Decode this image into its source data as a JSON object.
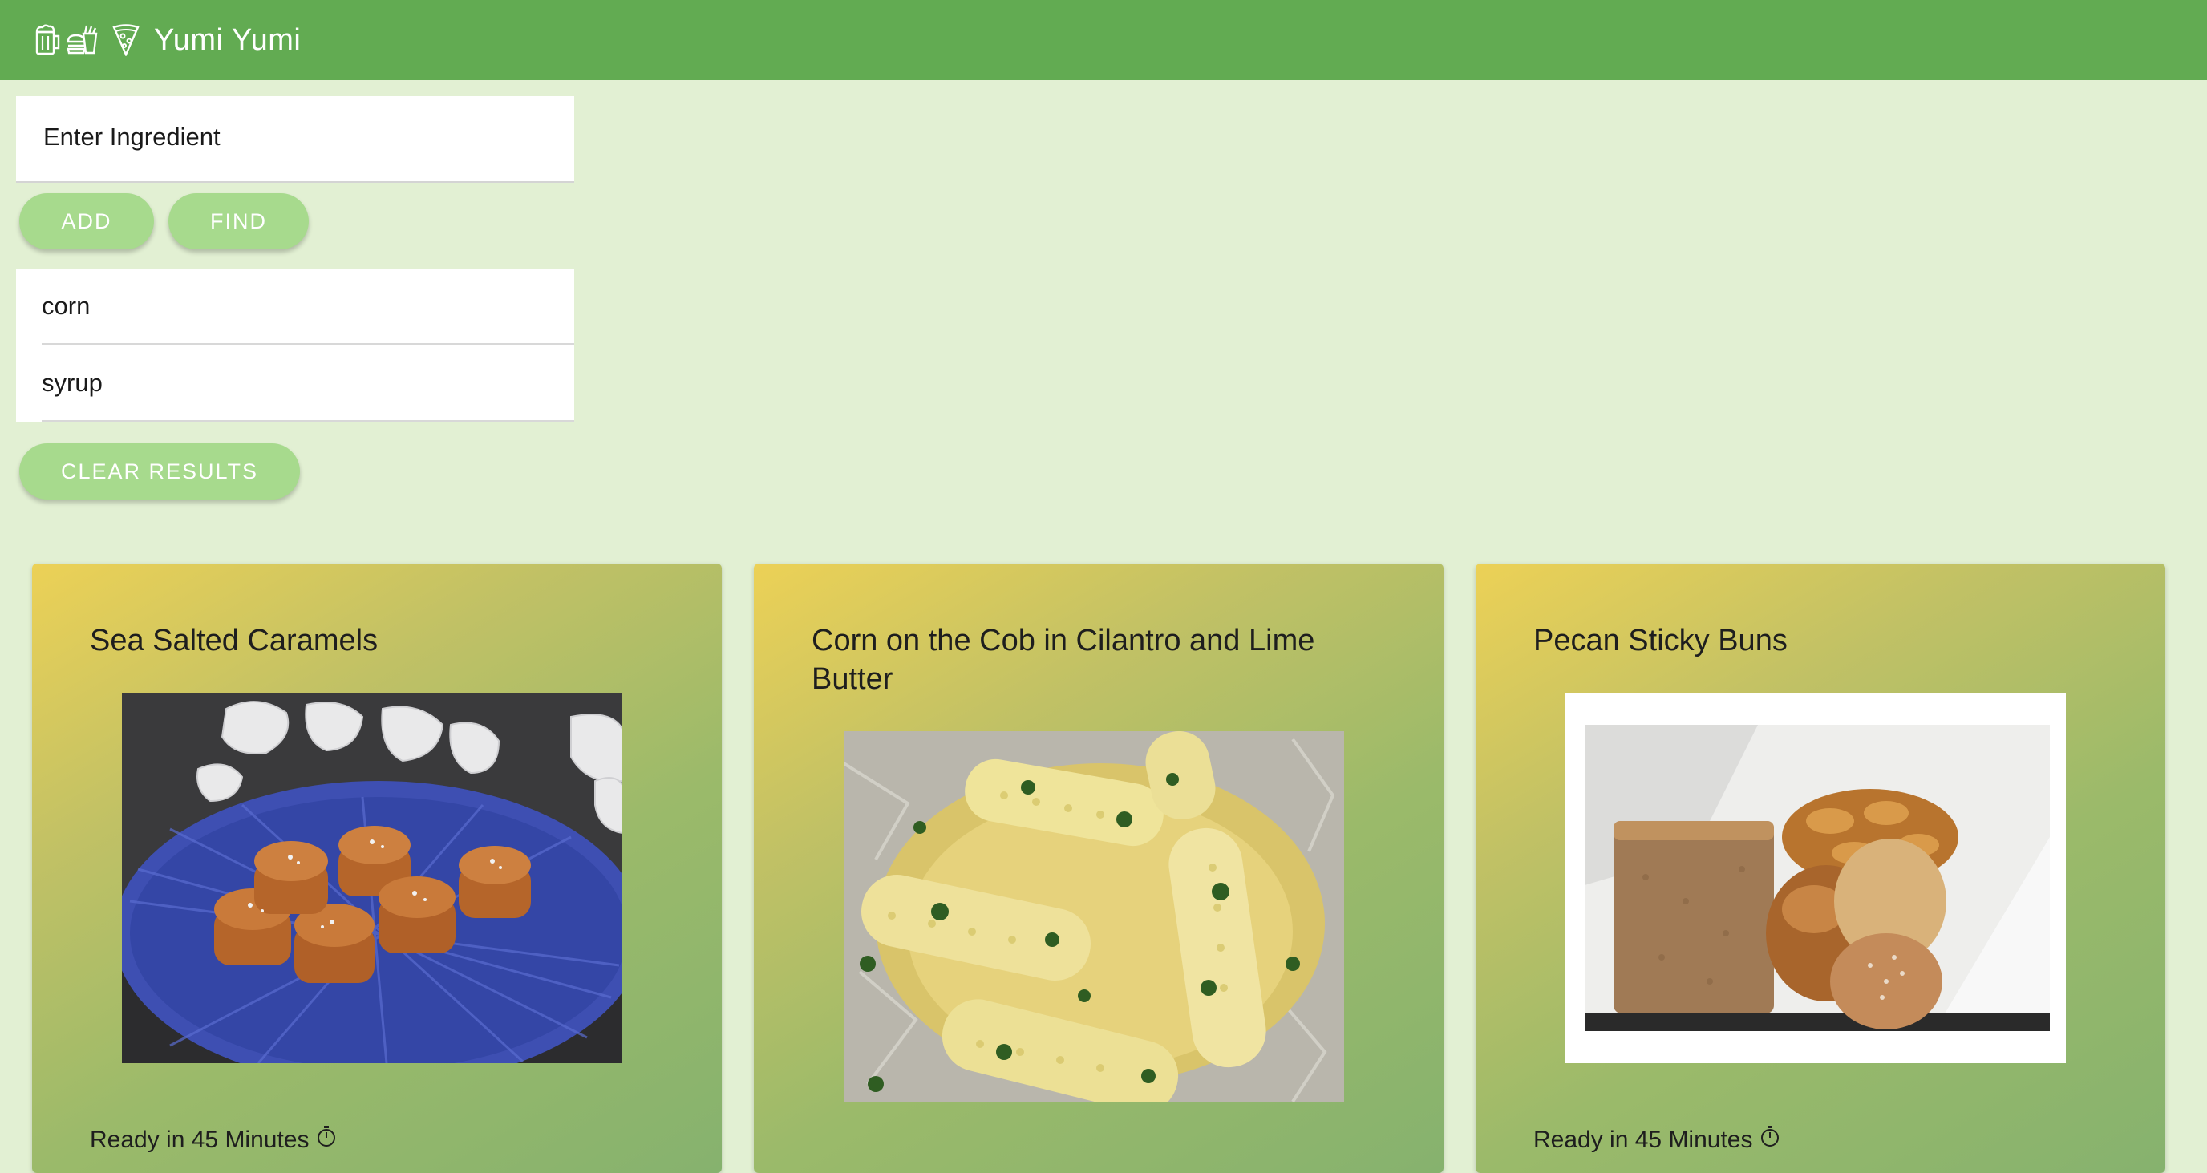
{
  "app": {
    "title": "Yumi Yumi"
  },
  "header_icons": [
    "beer-mug-icon",
    "fries-burger-icon",
    "pizza-slice-icon"
  ],
  "search": {
    "placeholder": "Enter Ingredient",
    "value": ""
  },
  "buttons": {
    "add": "ADD",
    "find": "FIND",
    "clear": "CLEAR RESULTS"
  },
  "ingredients": [
    "corn",
    "syrup"
  ],
  "recipes": [
    {
      "title": "Sea Salted Caramels",
      "ready": "Ready in 45 Minutes",
      "photo": "caramels-photo"
    },
    {
      "title": "Corn on the Cob in Cilantro and Lime Butter",
      "ready": "",
      "photo": "corn-cob-photo"
    },
    {
      "title": "Pecan Sticky Buns",
      "ready": "Ready in 45 Minutes",
      "photo": "sticky-buns-photo"
    }
  ],
  "colors": {
    "header": "#62ab52",
    "background": "#e2f0d3",
    "button": "#a7da8d",
    "card_gradient_start": "#ecd156",
    "card_gradient_end": "#86b26e"
  }
}
